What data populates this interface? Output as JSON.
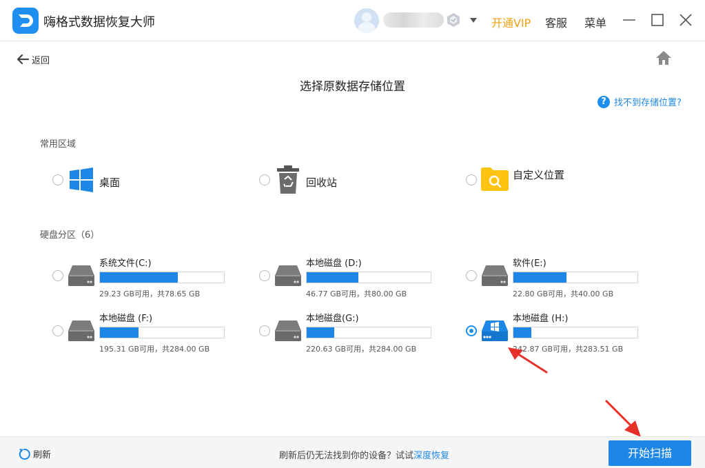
{
  "app": {
    "title": "嗨格式数据恢复大师"
  },
  "topbar": {
    "vip": "开通VIP",
    "service": "客服",
    "menu": "菜单"
  },
  "nav": {
    "back": "返回"
  },
  "page": {
    "title": "选择原数据存储位置",
    "help": "找不到存储位置?"
  },
  "common": {
    "label": "常用区域",
    "items": [
      {
        "label": "桌面",
        "icon": "windows-icon"
      },
      {
        "label": "回收站",
        "icon": "recycle-bin-icon"
      },
      {
        "label": "自定义位置",
        "icon": "folder-search-icon"
      }
    ]
  },
  "drives_section": {
    "label": "硬盘分区（6）"
  },
  "drives": [
    {
      "name": "系统文件(C:)",
      "size": "29.23 GB可用，共78.65 GB",
      "used_fraction": 0.628,
      "selected": false,
      "icon": "hard-drive-icon"
    },
    {
      "name": "本地磁盘 (D:)",
      "size": "46.77 GB可用，共80.00 GB",
      "used_fraction": 0.415,
      "selected": false,
      "icon": "hard-drive-icon"
    },
    {
      "name": "软件(E:)",
      "size": "22.80 GB可用，共40.00 GB",
      "used_fraction": 0.43,
      "selected": false,
      "icon": "hard-drive-icon"
    },
    {
      "name": "本地磁盘 (F:)",
      "size": "195.31 GB可用，共284.00 GB",
      "used_fraction": 0.312,
      "selected": false,
      "icon": "hard-drive-icon"
    },
    {
      "name": "本地磁盘(G:)",
      "size": "220.63 GB可用，共284.00 GB",
      "used_fraction": 0.223,
      "selected": false,
      "icon": "hard-drive-icon"
    },
    {
      "name": "本地磁盘 (H:)",
      "size": "242.87 GB可用，共283.51 GB",
      "used_fraction": 0.143,
      "selected": true,
      "icon": "windows-drive-icon"
    }
  ],
  "footer": {
    "refresh": "刷新",
    "hint": "刷新后仍无法找到你的设备？试试",
    "deep": "深度恢复",
    "start": "开始扫描"
  },
  "colors": {
    "accent": "#1e87e6",
    "vip": "#f0a012",
    "annotation": "#e8302a"
  }
}
